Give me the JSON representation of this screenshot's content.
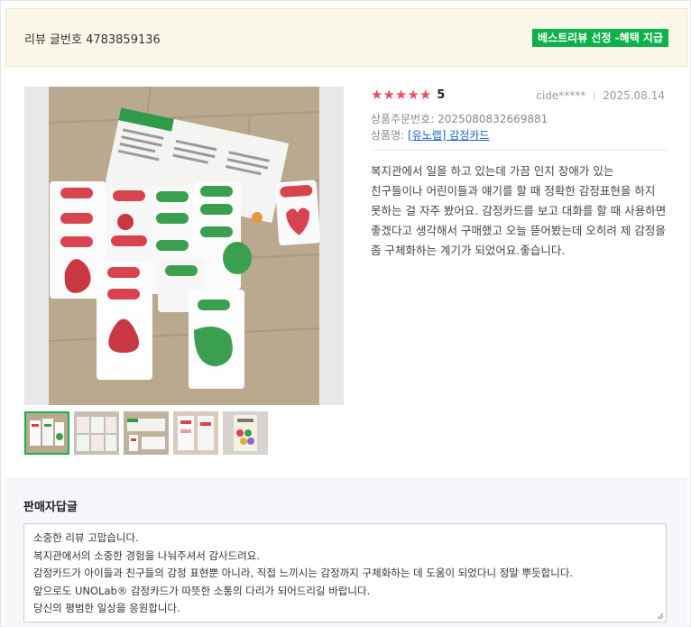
{
  "review": {
    "number_label": "리뷰 글번호 4783859136",
    "badge": "베스트리뷰 선정 -혜택 지급",
    "rating": {
      "stars": 5,
      "score": "5"
    },
    "author": "cide*****",
    "date": "2025.08.14",
    "order_number": "상품주문번호: 2025080832669881",
    "product_prefix": "상품명: ",
    "product_name": "[유노랩] 감정카드",
    "body": "복지관에서 일을 하고 있는데 가끔 인지 장애가 있는 친구들이나 어린이들과 얘기를 할 때 정확한 감정표현을 하지 못하는 걸 자주 봤어요. 감정카드를 보고 대화를 할 때 사용하면 좋겠다고 생각해서 구매했고 오늘 뜯어봤는데 오히려 제 감정을 좀 구체화하는 계기가 되었어요.좋습니다."
  },
  "photos": {
    "thumbnail_count": 5,
    "selected_index": 0
  },
  "seller_reply": {
    "title": "판매자답글",
    "lines": [
      "소중한 리뷰 고맙습니다.",
      "복지관에서의 소중한 경험을 나눠주셔서 감사드려요.",
      "감정카드가 아이들과 친구들의 감정 표현뿐 아니라, 직접 느끼시는 감정까지 구체화하는 데 도움이 되었다니 정말 뿌듯합니다.",
      "앞으로도 UNOLab® 감정카드가 따뜻한 소통의 다리가 되어드리길 바랍니다.",
      "당신의 평범한 일상을 응원합니다."
    ]
  },
  "colors": {
    "badge_green": "#0ab34a",
    "star_red": "#f04a5c",
    "link_blue": "#1b5fd6",
    "header_bg": "#fbf8e9"
  }
}
